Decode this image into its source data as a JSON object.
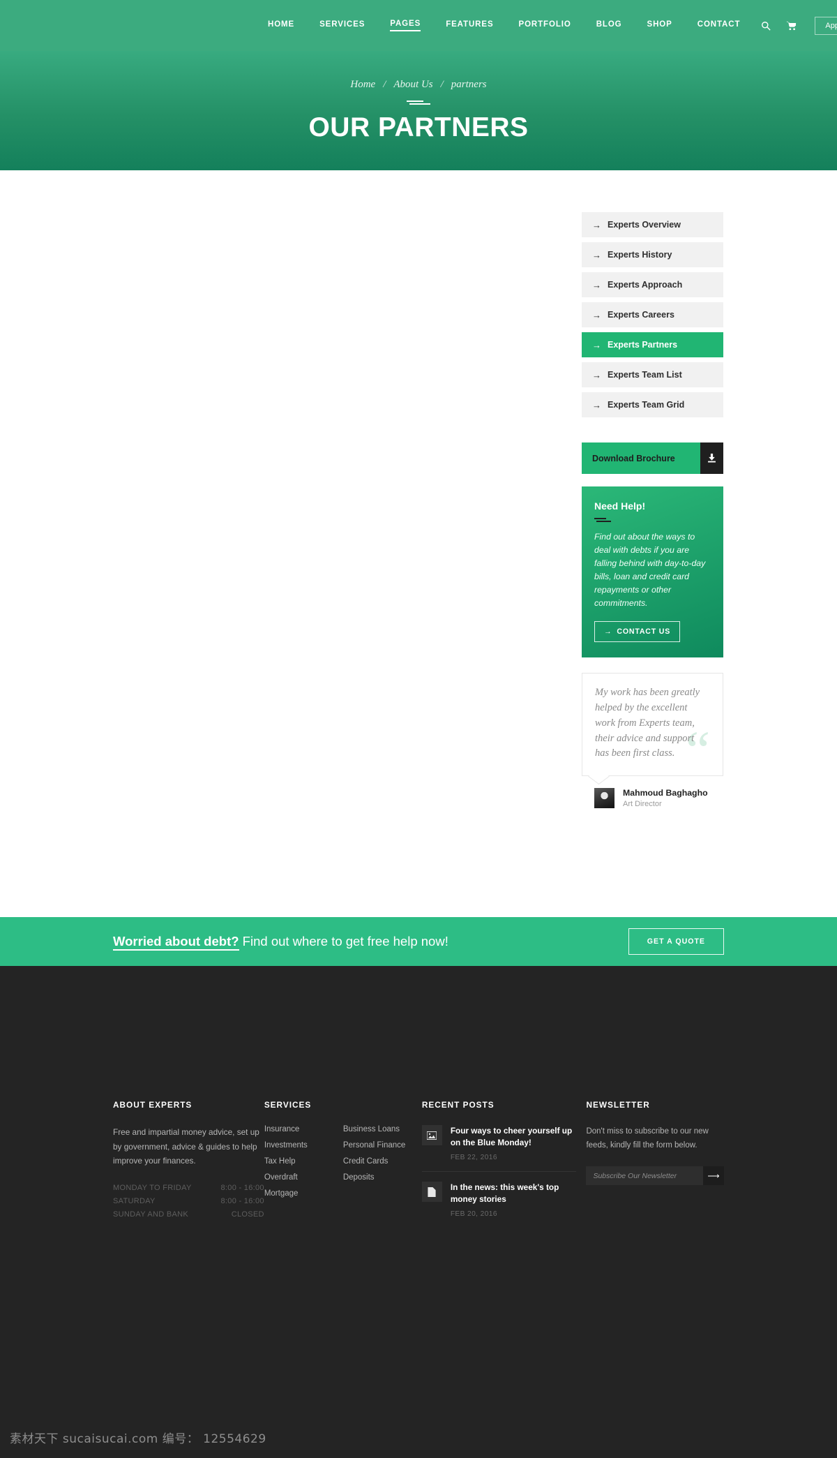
{
  "header": {
    "nav": [
      {
        "label": "HOME",
        "active": false
      },
      {
        "label": "SERVICES",
        "active": false
      },
      {
        "label": "PAGES",
        "active": true
      },
      {
        "label": "FEATURES",
        "active": false
      },
      {
        "label": "PORTFOLIO",
        "active": false
      },
      {
        "label": "BLOG",
        "active": false
      },
      {
        "label": "SHOP",
        "active": false
      },
      {
        "label": "CONTACT",
        "active": false
      }
    ],
    "search_icon": "search-icon",
    "cart_icon": "cart-icon",
    "appointment_label": "Appointment!",
    "bg_color": "#3cab7f"
  },
  "hero": {
    "breadcrumb": {
      "home": "Home",
      "section": "About Us",
      "current": "partners",
      "separator": "/"
    },
    "title": "OUR PARTNERS",
    "gradient_from": "#38ab80",
    "gradient_to": "#14805b"
  },
  "sidebar": {
    "links": [
      {
        "label": "Experts Overview",
        "active": false
      },
      {
        "label": "Experts History",
        "active": false
      },
      {
        "label": "Experts Approach",
        "active": false
      },
      {
        "label": "Experts Careers",
        "active": false
      },
      {
        "label": "Experts Partners",
        "active": true
      },
      {
        "label": "Experts Team List",
        "active": false
      },
      {
        "label": "Experts Team Grid",
        "active": false
      }
    ],
    "active_color": "#21b573",
    "brochure": {
      "label": "Download Brochure",
      "icon": "download-icon"
    },
    "need_help": {
      "title": "Need Help!",
      "body": "Find out about the ways to deal with debts if you are falling behind with day-to-day bills, loan and credit card repayments or other commitments.",
      "button_label": "CONTACT US"
    },
    "testimonial": {
      "quote": "My work has been greatly helped by the excellent work from Experts team, their advice and support has been first class.",
      "quote_mark": "“",
      "author": "Mahmoud Baghagho",
      "role": "Art Director"
    }
  },
  "cta": {
    "bold_text": "Worried about debt?",
    "rest_text": " Find out where to get free help now!",
    "button_label": "GET A QUOTE",
    "bg_color": "#2dbd85"
  },
  "footer": {
    "about": {
      "heading": "ABOUT EXPERTS",
      "text": "Free and impartial money advice, set up by government, advice & guides to help improve your finances.",
      "hours": [
        {
          "day": "MONDAY TO FRIDAY",
          "time": "8:00 - 16:00"
        },
        {
          "day": "SATURDAY",
          "time": "8:00 - 16:00"
        },
        {
          "day": "SUNDAY AND BANK",
          "time": "CLOSED"
        }
      ]
    },
    "services": {
      "heading": "SERVICES",
      "col1": [
        "Insurance",
        "Investments",
        "Tax Help",
        "Overdraft",
        "Mortgage"
      ],
      "col2": [
        "Business Loans",
        "Personal Finance",
        "Credit Cards",
        "Deposits"
      ]
    },
    "recent_posts": {
      "heading": "RECENT POSTS",
      "items": [
        {
          "title": "Four ways to cheer yourself up on the Blue Monday!",
          "date": "FEB 22, 2016",
          "icon": "image-icon"
        },
        {
          "title": "In the news: this week's top money stories",
          "date": "FEB 20, 2016",
          "icon": "document-icon"
        }
      ]
    },
    "newsletter": {
      "heading": "NEWSLETTER",
      "text": "Don't miss to subscribe to our new feeds, kindly fill the form below.",
      "placeholder": "Subscribe Our Newsletter",
      "value": "",
      "submit_icon": "arrow-right-icon"
    },
    "bg_color": "#242424"
  },
  "watermark": {
    "text": "素材天下 sucaisucai.com  编号： 12554629"
  }
}
